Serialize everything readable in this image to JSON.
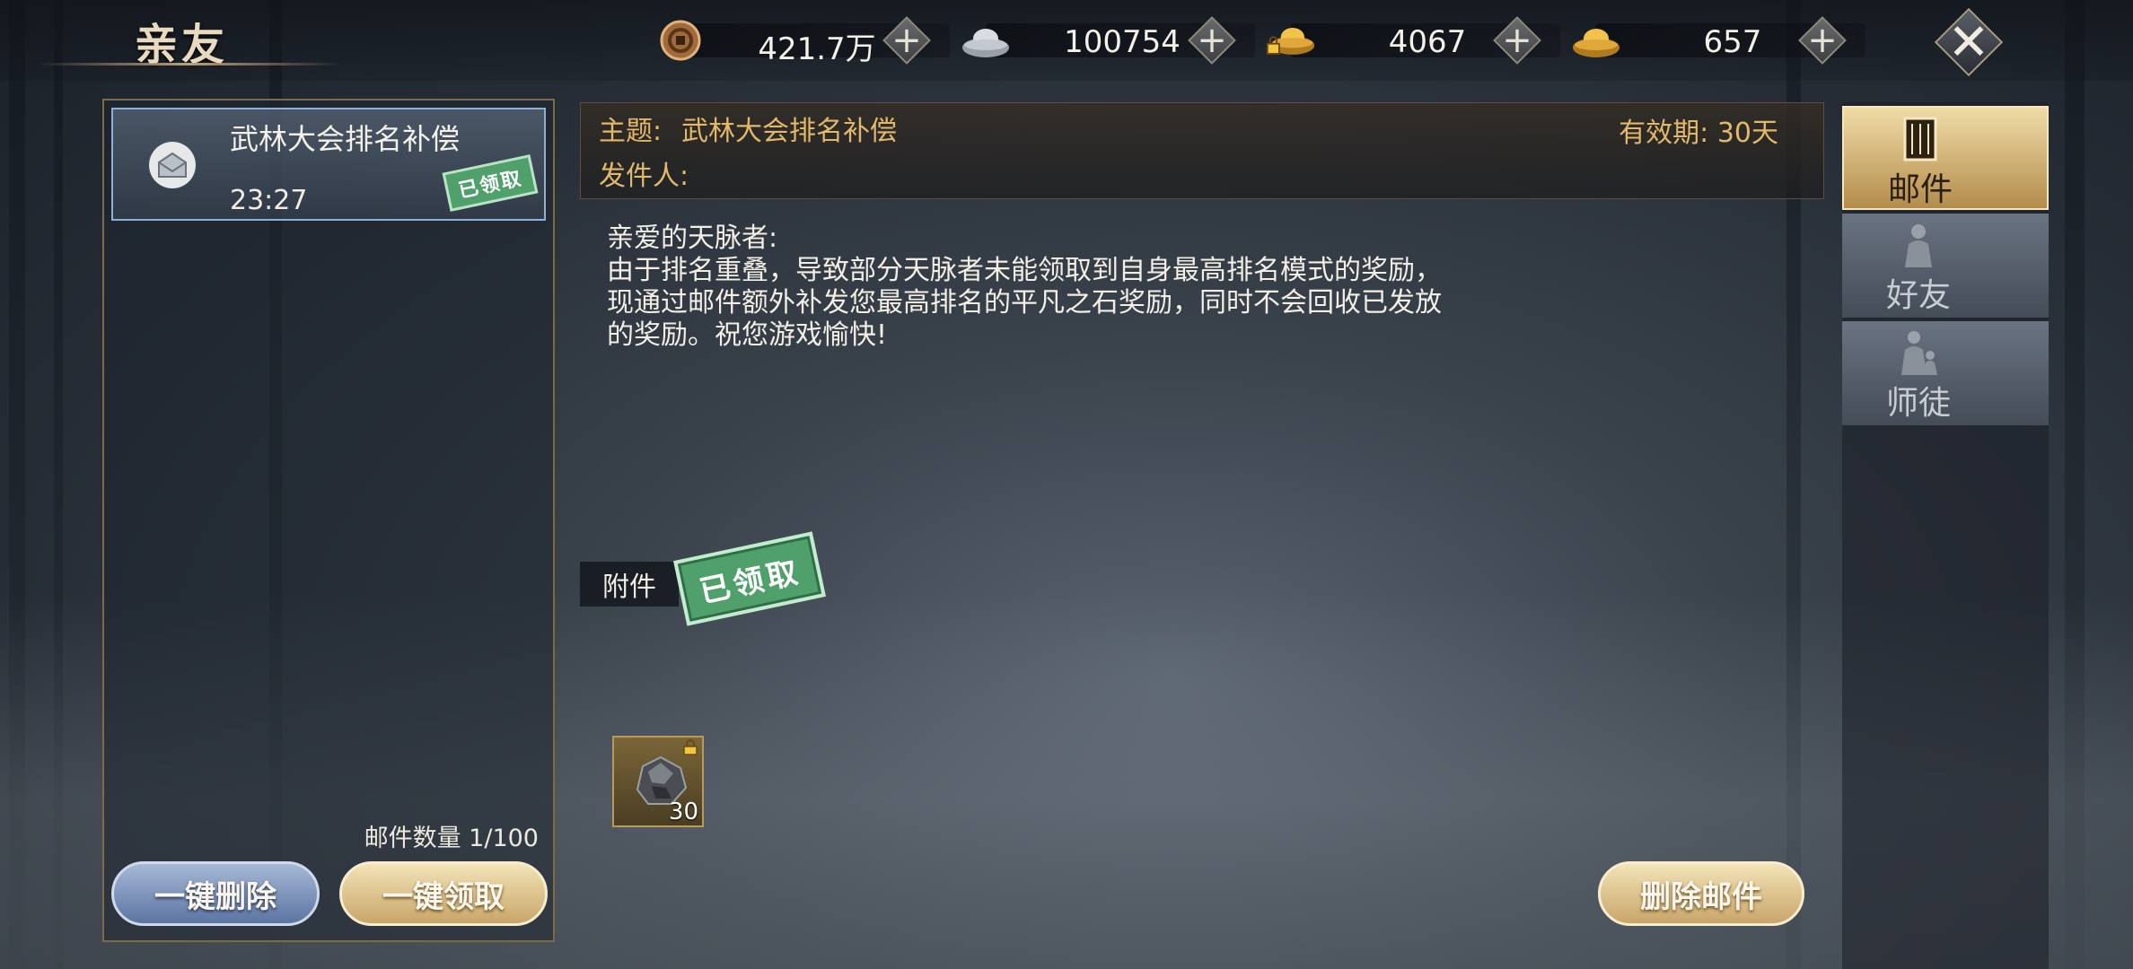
{
  "header": {
    "title": "亲友",
    "resources": [
      {
        "icon": "copper-coin-icon",
        "value": "421.7万"
      },
      {
        "icon": "silver-ingot-icon",
        "value": "100754"
      },
      {
        "icon": "locked-gold-ingot-icon",
        "value": "4067"
      },
      {
        "icon": "gold-ingot-icon",
        "value": "657"
      }
    ],
    "add_symbol": "+",
    "close_symbol": "✕"
  },
  "mail_list": {
    "items": [
      {
        "title": "武林大会排名补偿",
        "time": "23:27",
        "stamp": "已领取"
      }
    ],
    "count_text": "邮件数量 1/100",
    "delete_all_label": "一键删除",
    "claim_all_label": "一键领取"
  },
  "mail_detail": {
    "subject_label": "主题:",
    "subject": "武林大会排名补偿",
    "sender_label": "发件人:",
    "validity": "有效期: 30天",
    "body": "亲爱的天脉者:\n由于排名重叠，导致部分天脉者未能领取到自身最高排名模式的奖励，\n现通过邮件额外补发您最高排名的平凡之石奖励，同时不会回收已发放\n的奖励。祝您游戏愉快!",
    "attachment_label": "附件",
    "attachment_stamp": "已领取",
    "attachment_item": {
      "icon": "ordinary-stone-icon",
      "count": "30"
    },
    "delete_label": "删除邮件"
  },
  "side_tabs": [
    {
      "label": "邮件",
      "active": true
    },
    {
      "label": "好友",
      "active": false
    },
    {
      "label": "师徒",
      "active": false
    }
  ],
  "colors": {
    "gold_text": "#e2b86a",
    "stamp_green": "#4fa06b",
    "active_tab": "#d9bf84"
  }
}
